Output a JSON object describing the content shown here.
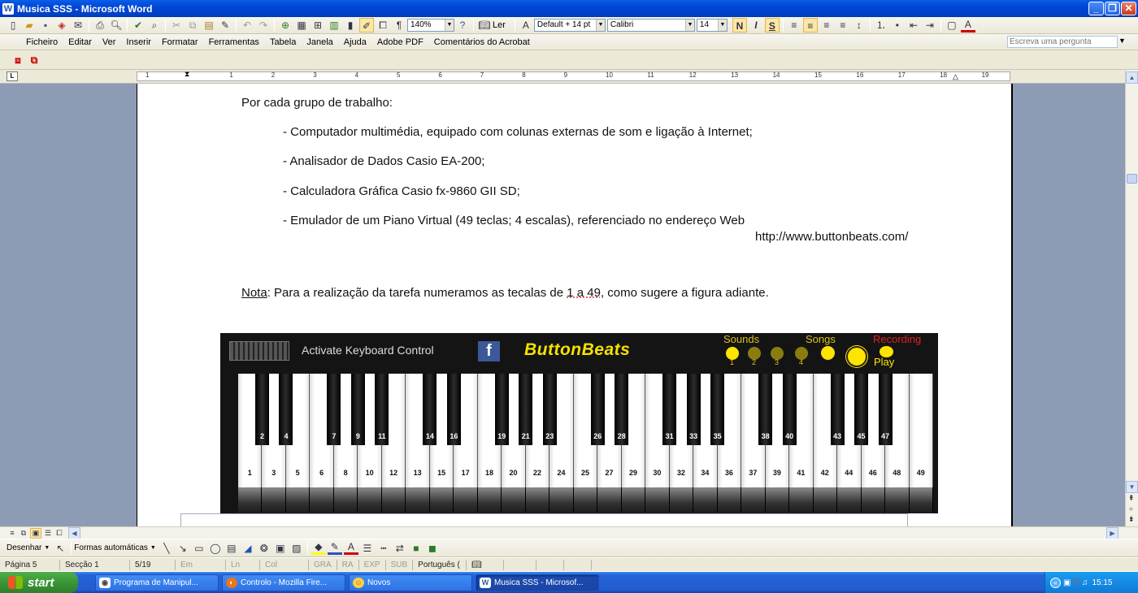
{
  "window": {
    "title": "Musica SSS - Microsoft Word",
    "app_icon": "word-icon",
    "controls": [
      "minimize-icon",
      "restore-icon",
      "close-icon"
    ]
  },
  "toolbar": {
    "zoom": "140%",
    "read_label": "Ler",
    "style": "Default + 14 pt",
    "font": "Calibri",
    "size": "14",
    "bold": "N",
    "italic": "I",
    "underline": "S",
    "icons": [
      "new-icon",
      "open-icon",
      "save-icon",
      "permission-icon",
      "email-icon",
      "print-icon",
      "print-preview-icon",
      "spelling-icon",
      "research-icon",
      "cut-icon",
      "copy-icon",
      "paste-icon",
      "format-painter-icon",
      "undo-icon",
      "redo-icon",
      "hyperlink-icon",
      "tables-borders-icon",
      "insert-table-icon",
      "insert-excel-icon",
      "columns-icon",
      "drawing-icon",
      "document-map-icon",
      "show-hide-icon",
      "help-icon"
    ]
  },
  "menu": {
    "items": [
      "Ficheiro",
      "Editar",
      "Ver",
      "Inserir",
      "Formatar",
      "Ferramentas",
      "Tabela",
      "Janela",
      "Ajuda",
      "Adobe PDF",
      "Comentários do Acrobat"
    ],
    "search_placeholder": "Escreva uma pergunta"
  },
  "ruler": {
    "labels": [
      "1",
      "1",
      "2",
      "3",
      "4",
      "5",
      "6",
      "7",
      "8",
      "9",
      "10",
      "11",
      "12",
      "13",
      "14",
      "15",
      "16",
      "17",
      "18",
      "19"
    ]
  },
  "document": {
    "heading": "Por cada grupo de trabalho:",
    "items": [
      "- Computador multimédia, equipado com colunas externas de som e ligação à Internet;",
      "- Analisador de Dados Casio EA-200;",
      "- Calculadora Gráfica Casio fx-9860 GII SD;",
      "- Emulador de um Piano Virtual (49 teclas; 4 escalas), referenciado no endereço Web"
    ],
    "url": "http://www.buttonbeats.com/",
    "note_label": "Nota",
    "note_text": ": Para a realização da tarefa numeramos as tecalas de ",
    "note_range": "1 a 49",
    "note_end": ", como sugere a figura adiante."
  },
  "piano": {
    "keyboard_control": "Activate Keyboard Control",
    "facebook": "f",
    "logo": "ButtonBeats",
    "sounds_label": "Sounds",
    "sound_nums": [
      "1",
      "2",
      "3",
      "4"
    ],
    "songs_label": "Songs",
    "recording_label": "Recording",
    "play_label": "Play",
    "white_keys": [
      "1",
      "3",
      "5",
      "6",
      "8",
      "10",
      "12",
      "13",
      "15",
      "17",
      "18",
      "20",
      "22",
      "24",
      "25",
      "27",
      "29",
      "30",
      "32",
      "34",
      "36",
      "37",
      "39",
      "41",
      "42",
      "44",
      "46",
      "48",
      "49"
    ],
    "black_keys": [
      {
        "label": "2",
        "after": 1
      },
      {
        "label": "4",
        "after": 2
      },
      {
        "label": "7",
        "after": 4
      },
      {
        "label": "9",
        "after": 5
      },
      {
        "label": "11",
        "after": 6
      },
      {
        "label": "14",
        "after": 8
      },
      {
        "label": "16",
        "after": 9
      },
      {
        "label": "19",
        "after": 11
      },
      {
        "label": "21",
        "after": 12
      },
      {
        "label": "23",
        "after": 13
      },
      {
        "label": "26",
        "after": 15
      },
      {
        "label": "28",
        "after": 16
      },
      {
        "label": "31",
        "after": 18
      },
      {
        "label": "33",
        "after": 19
      },
      {
        "label": "35",
        "after": 20
      },
      {
        "label": "38",
        "after": 22
      },
      {
        "label": "40",
        "after": 23
      },
      {
        "label": "43",
        "after": 25
      },
      {
        "label": "45",
        "after": 26
      },
      {
        "label": "47",
        "after": 27
      }
    ]
  },
  "drawing_toolbar": {
    "draw_label": "Desenhar",
    "autoshapes_label": "Formas automáticas"
  },
  "status": {
    "page": "Página  5",
    "section": "Secção  1",
    "pages": "5/19",
    "at": "Em",
    "ln": "Ln",
    "col": "Col",
    "modes": [
      "GRA",
      "RA",
      "EXP",
      "SUB"
    ],
    "language": "Português ("
  },
  "taskbar": {
    "start": "start",
    "tasks": [
      "Programa de Manipul...",
      "Controlo - Mozilla Fire...",
      "Novos",
      "Musica SSS - Microsof..."
    ],
    "time": "15:15"
  }
}
